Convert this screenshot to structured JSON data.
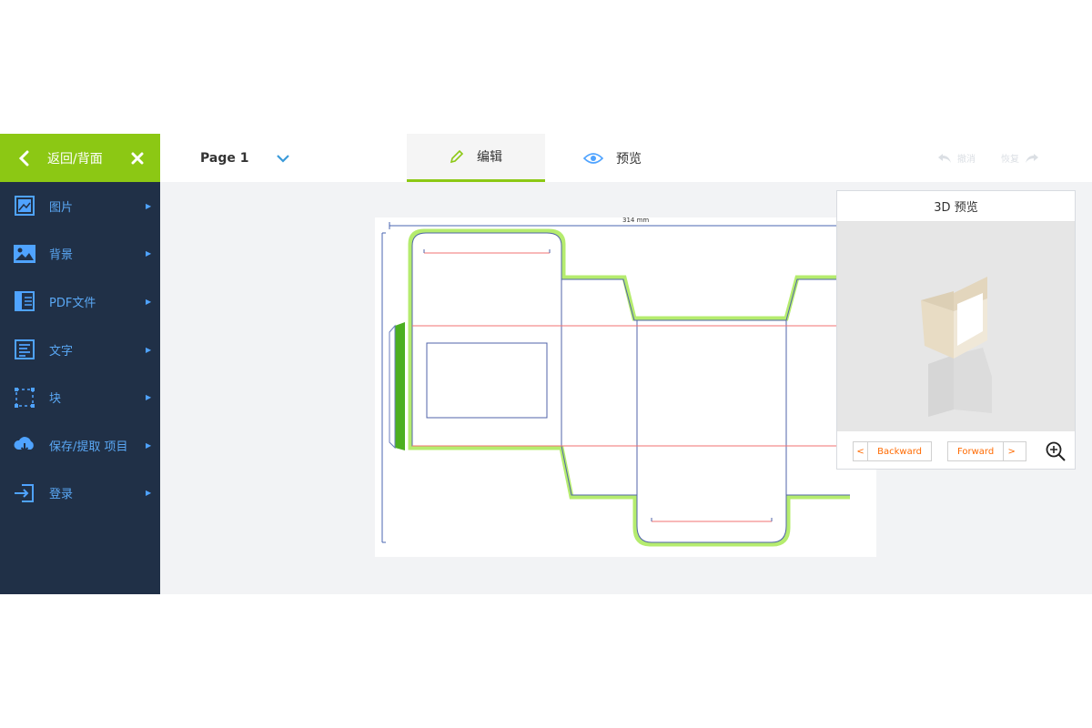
{
  "sidebar": {
    "header_title": "返回/背面",
    "items": [
      {
        "label": "图片",
        "icon": "image-frame-icon"
      },
      {
        "label": "背景",
        "icon": "landscape-icon"
      },
      {
        "label": "PDF文件",
        "icon": "pdf-layout-icon"
      },
      {
        "label": "文字",
        "icon": "text-lines-icon"
      },
      {
        "label": "块",
        "icon": "block-selection-icon"
      },
      {
        "label": "保存/提取 项目",
        "icon": "cloud-download-icon"
      },
      {
        "label": "登录",
        "icon": "login-icon"
      }
    ]
  },
  "topbar": {
    "page_label": "Page 1",
    "tab_edit": "编辑",
    "tab_preview": "预览",
    "undo": "撤消",
    "redo": "恢复"
  },
  "canvas": {
    "dimension_label": "314 mm"
  },
  "preview3d": {
    "title": "3D 预览",
    "backward": "Backward",
    "forward": "Forward",
    "back_arrow": "<",
    "fwd_arrow": ">"
  },
  "colors": {
    "accent_green": "#8cc814",
    "sidebar_bg": "#203047",
    "link_blue": "#4fa3ff",
    "orange": "#ff6a00"
  }
}
